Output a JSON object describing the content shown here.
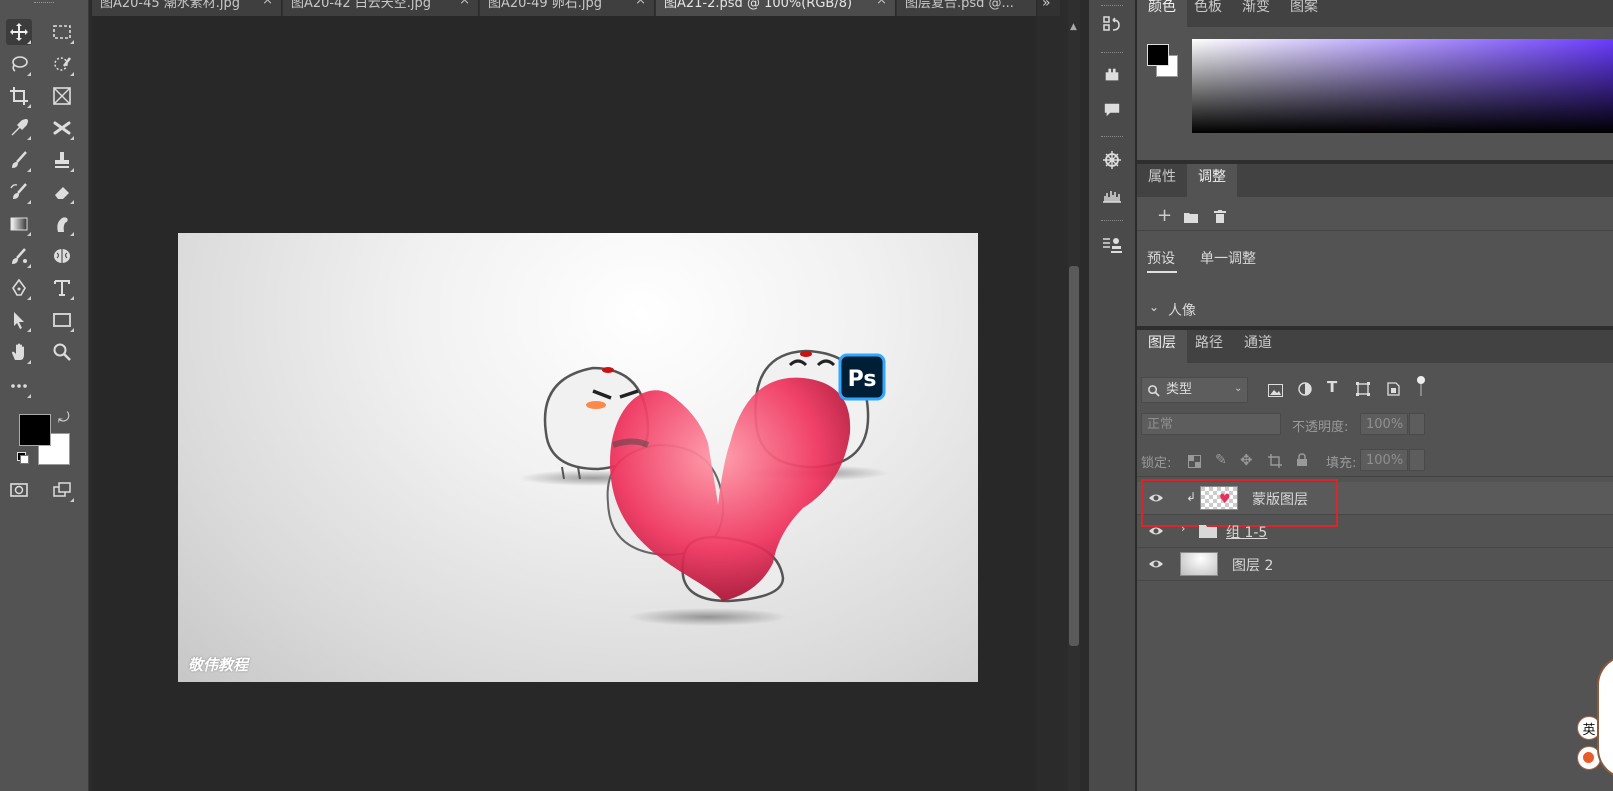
{
  "tabs": [
    {
      "label": "图A20-45 潮水素材.jpg",
      "active": false
    },
    {
      "label": "图A20-42 白云天空.jpg",
      "active": false
    },
    {
      "label": "图A20-49 卵石.jpg",
      "active": false
    },
    {
      "label": "图A21-2.psd @ 100%(RGB/8)",
      "active": true
    },
    {
      "label": "图层复合.psd @...",
      "active": false
    }
  ],
  "tab_overflow": "»",
  "canvas": {
    "watermark": "敬伟教程",
    "ps_badge": "Ps"
  },
  "panels": {
    "color_tabs": [
      "颜色",
      "色板",
      "渐变",
      "图案"
    ],
    "props_tabs": [
      "属性",
      "调整"
    ],
    "adjust": {
      "subtabs": [
        "预设",
        "单一调整"
      ],
      "section_label": "人像"
    },
    "layer_tabs": [
      "图层",
      "路径",
      "通道"
    ],
    "filter": {
      "label": "类型"
    },
    "blend_mode": "正常",
    "opacity_label": "不透明度:",
    "opacity_value": "100%",
    "lock_label": "锁定:",
    "fill_label": "填充:",
    "fill_value": "100%",
    "layers": [
      {
        "name": "蒙版图层",
        "highlighted": true,
        "clipped": true
      },
      {
        "name": "组 1-5",
        "type": "group"
      },
      {
        "name": "图层 2"
      }
    ]
  },
  "ime_indicator": "英",
  "colors": {
    "accent_highlight": "#d9262c",
    "ui_dark": "#282828",
    "panel_bg": "#535353",
    "ps_blue": "#31a8ff"
  }
}
